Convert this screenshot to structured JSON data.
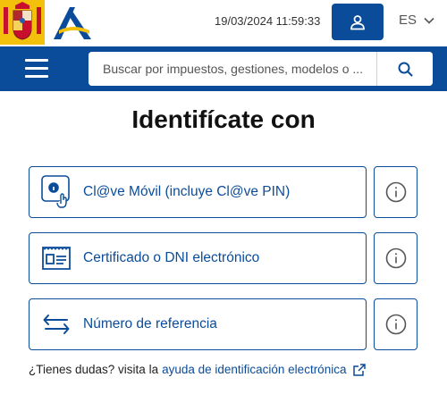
{
  "header": {
    "datetime": "19/03/2024 11:59:33",
    "language": "ES",
    "icons": {
      "coat": "spain-coat-of-arms-icon",
      "logo": "agencia-tributaria-logo-icon",
      "user": "user-icon",
      "lang": "chevron-down-icon"
    }
  },
  "nav": {
    "menu_icon": "hamburger-menu-icon",
    "search_placeholder": "Buscar por impuestos, gestiones, modelos o ...",
    "search_icon": "search-icon"
  },
  "main": {
    "title": "Identifícate con",
    "options": [
      {
        "label": "Cl@ve Móvil (incluye Cl@ve PIN)",
        "icon": "clave-movil-icon",
        "info_icon": "info-icon"
      },
      {
        "label": "Certificado o DNI electrónico",
        "icon": "certificate-card-icon",
        "info_icon": "info-icon"
      },
      {
        "label": "Número de referencia",
        "icon": "swap-arrows-icon",
        "info_icon": "info-icon"
      }
    ],
    "help_text": "¿Tienes dudas? visita la",
    "help_link": "ayuda de identificación electrónica",
    "help_link_icon": "external-link-icon"
  },
  "colors": {
    "brand_blue": "#0b4c9a",
    "coat_yellow": "#f3c00b"
  }
}
